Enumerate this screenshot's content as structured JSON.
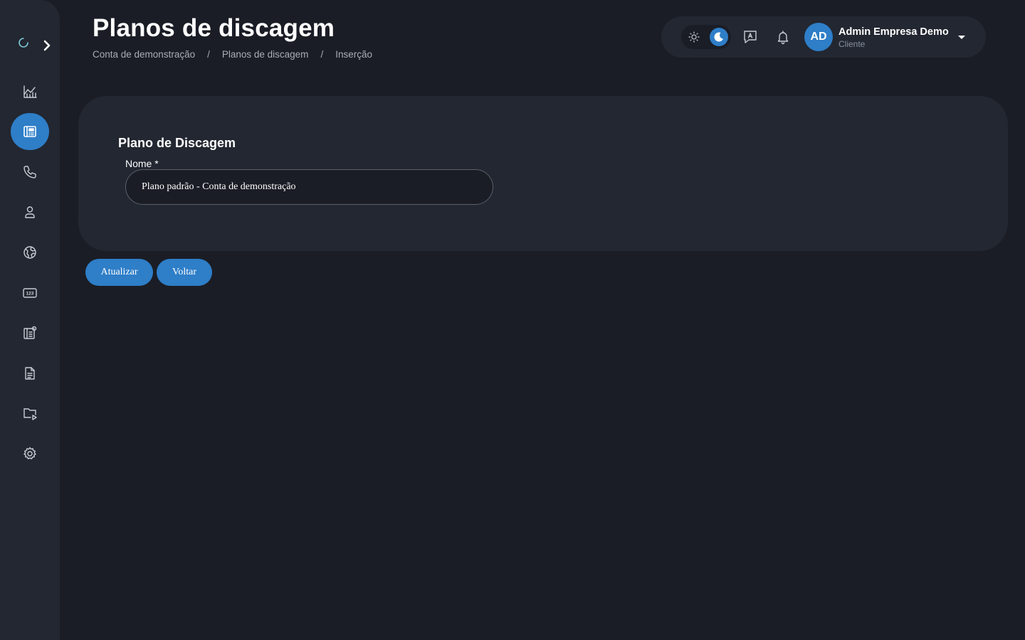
{
  "header": {
    "title": "Planos de discagem",
    "breadcrumb": [
      "Conta de demonstração",
      "Planos de discagem",
      "Inserção"
    ],
    "separator": "/"
  },
  "user": {
    "initials": "AD",
    "name": "Admin Empresa Demo",
    "role": "Cliente"
  },
  "theme": {
    "active": "dark"
  },
  "sidebar": {
    "items": [
      {
        "icon": "chart-icon",
        "active": false
      },
      {
        "icon": "dialplan-icon",
        "active": true
      },
      {
        "icon": "phone-icon",
        "active": false
      },
      {
        "icon": "user-icon",
        "active": false
      },
      {
        "icon": "globe-icon",
        "active": false
      },
      {
        "icon": "numbers-icon",
        "active": false
      },
      {
        "icon": "settings-book-icon",
        "active": false
      },
      {
        "icon": "document-icon",
        "active": false
      },
      {
        "icon": "media-folder-icon",
        "active": false
      },
      {
        "icon": "gear-icon",
        "active": false
      }
    ]
  },
  "form": {
    "section_title": "Plano de Discagem",
    "name_label": "Nome *",
    "name_value": "Plano padrão - Conta de demonstração"
  },
  "actions": {
    "update_label": "Atualizar",
    "back_label": "Voltar"
  },
  "colors": {
    "accent": "#2e7ec8",
    "background": "#1a1d25",
    "panel": "#222731"
  }
}
